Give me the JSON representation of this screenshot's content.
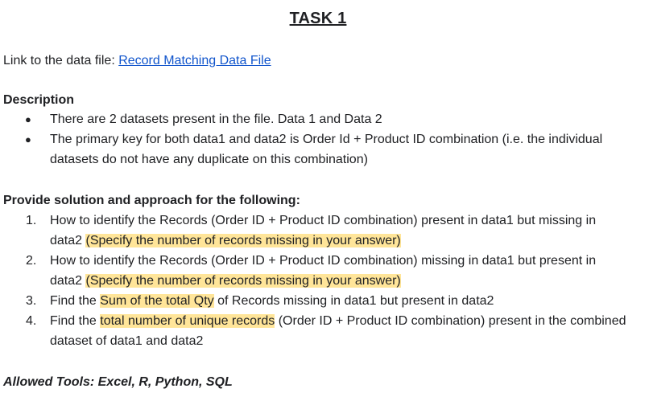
{
  "title": "TASK 1",
  "link_line": {
    "prefix": "Link to the data file: ",
    "link_text": "Record Matching Data File"
  },
  "description": {
    "heading": "Description",
    "bullets": [
      "There are 2 datasets present in the file. Data 1 and Data 2",
      "The primary key for both data1 and data2 is Order Id + Product ID combination (i.e. the individual datasets do not have any duplicate on this combination)"
    ]
  },
  "solution": {
    "heading": "Provide solution and approach for the following:",
    "items": [
      {
        "num": "1.",
        "before": "How to identify the Records (Order ID + Product ID combination) present in data1 but missing in data2 ",
        "highlight": "(Specify the number of records missing in your answer)",
        "after": ""
      },
      {
        "num": "2.",
        "before": "How to identify the Records (Order ID + Product ID combination) missing in data1 but present in data2 ",
        "highlight": "(Specify the number of records missing in your answer)",
        "after": ""
      },
      {
        "num": "3.",
        "before": "Find the ",
        "highlight": "Sum of the total Qty",
        "after": " of Records missing in data1 but present in data2"
      },
      {
        "num": "4.",
        "before": "Find the ",
        "highlight": "total number of unique records",
        "after": " (Order ID + Product ID combination) present in the combined dataset of data1 and data2"
      }
    ]
  },
  "tools": "Allowed Tools: Excel, R, Python, SQL"
}
